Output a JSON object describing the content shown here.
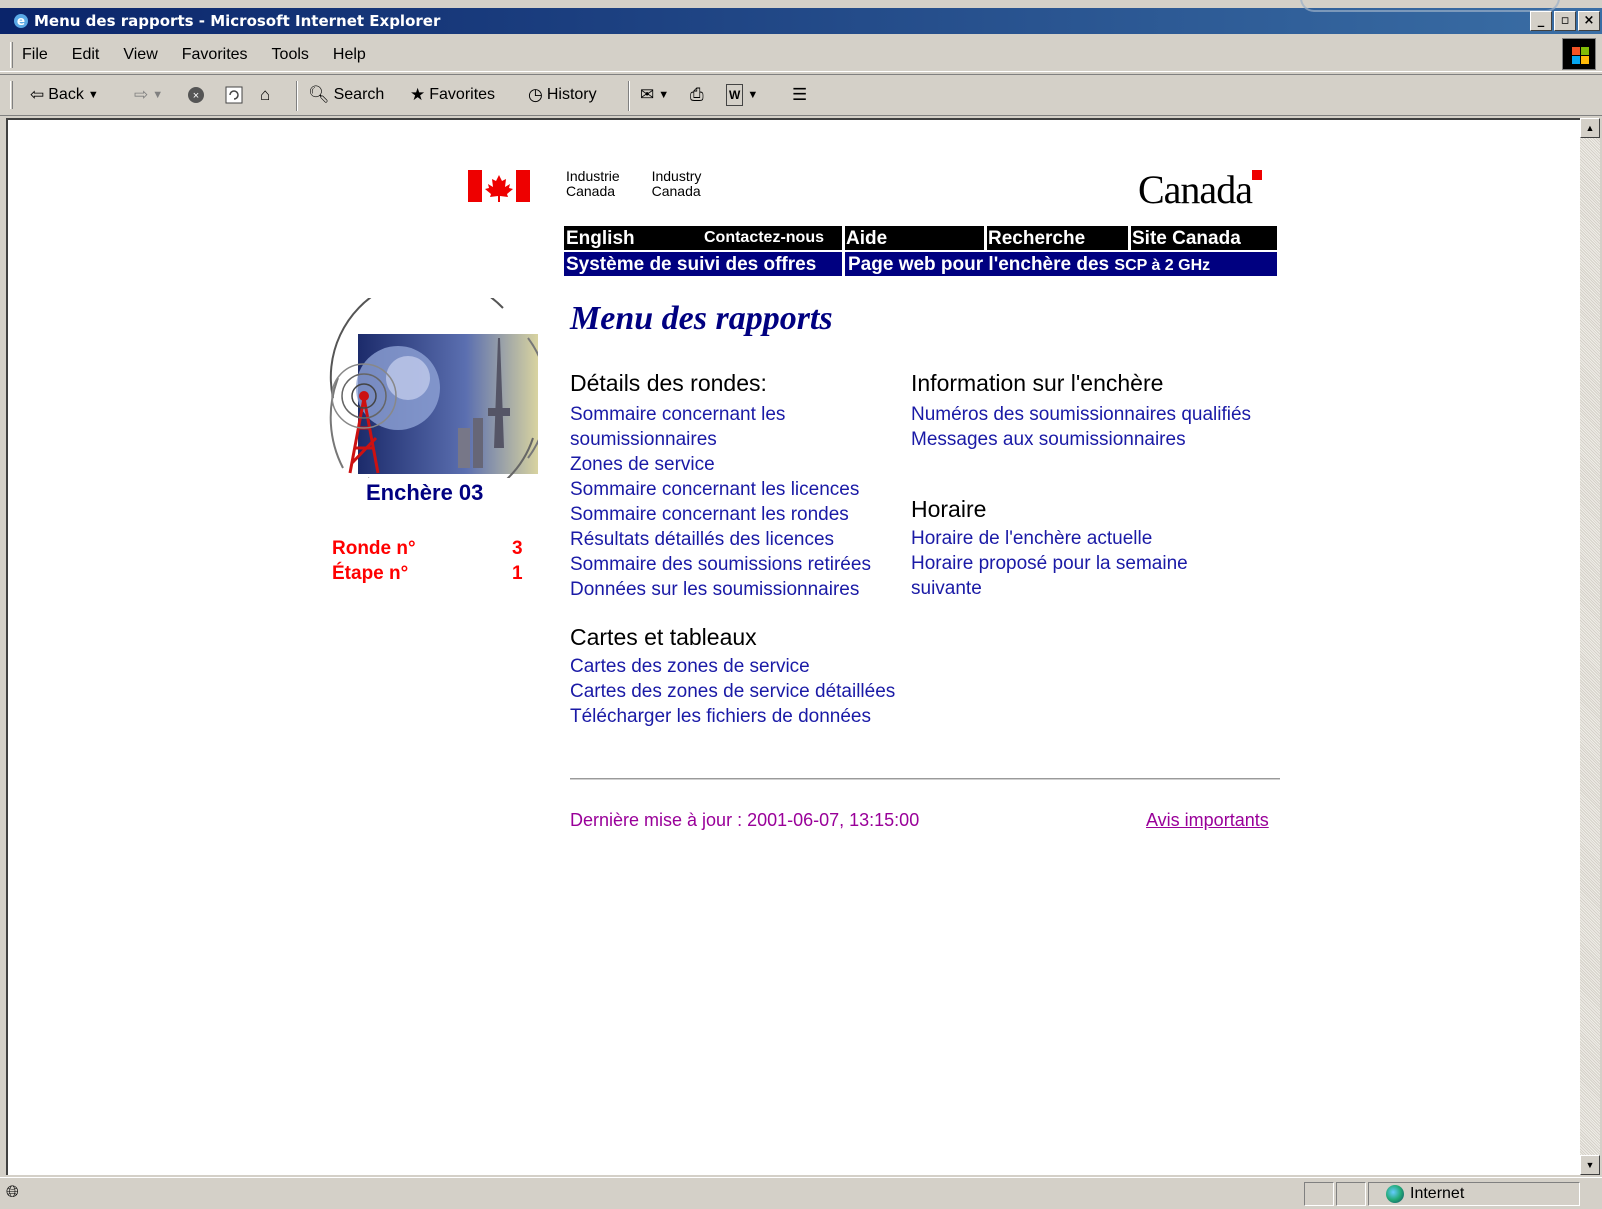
{
  "window": {
    "title": "Menu des rapports - Microsoft Internet Explorer",
    "buttons": [
      "_",
      "̈",
      "×"
    ]
  },
  "menubar": {
    "items": [
      "File",
      "Edit",
      "View",
      "Favorites",
      "Tools",
      "Help"
    ]
  },
  "toolbar": {
    "back": "Back",
    "search": "Search",
    "favorites": "Favorites",
    "history": "History"
  },
  "statusbar": {
    "zone": "Internet"
  },
  "page": {
    "signature": {
      "fr": [
        "Industrie",
        "Canada"
      ],
      "en": [
        "Industry",
        "Canada"
      ]
    },
    "wordmark": "Canada",
    "nav": {
      "english": "English",
      "contact": "Contactez-nous",
      "help": "Aide",
      "search": "Recherche",
      "site": "Site Canada"
    },
    "band": {
      "system": "Système de suivi des offres",
      "auction_page": "Page web pour l'enchère des",
      "auction_page_suffix": "SCP à 2 GHz"
    },
    "heading": "Menu des rapports",
    "auction": {
      "name": "Enchère 03",
      "round_label": "Ronde n°",
      "round_value": "3",
      "stage_label": "Étape n°",
      "stage_value": "1"
    },
    "sections": {
      "round_details": {
        "title": "Détails des rondes:",
        "links": [
          "Sommaire concernant les",
          "soumissionnaires",
          "Zones de service",
          "Sommaire concernant les licences",
          "Sommaire concernant les rondes",
          "Résultats détaillés des licences",
          "Sommaire des soumissions retirées",
          "Données sur les soumissionnaires"
        ]
      },
      "auction_info": {
        "title": "Information sur l'enchère",
        "links": [
          "Numéros des soumissionnaires qualifiés",
          "Messages aux soumissionnaires"
        ]
      },
      "schedule": {
        "title": "Horaire",
        "links": [
          "Horaire de l'enchère actuelle",
          "Horaire proposé pour la semaine",
          "suivante"
        ]
      },
      "maps": {
        "title": "Cartes et tableaux",
        "links": [
          "Cartes des zones de service",
          "Cartes des zones de service détaillées",
          "Télécharger les fichiers de données"
        ]
      }
    },
    "footer": {
      "updated": "Dernière mise à jour : 2001-06-07, 13:15:00",
      "notices": "Avis importants"
    }
  },
  "colors": {
    "titlebar": "#0a246a",
    "nav_black": "#000000",
    "band_blue": "#000080",
    "link": "#1a1aa6",
    "round_red": "#ff0000",
    "footer_purple": "#990099"
  }
}
